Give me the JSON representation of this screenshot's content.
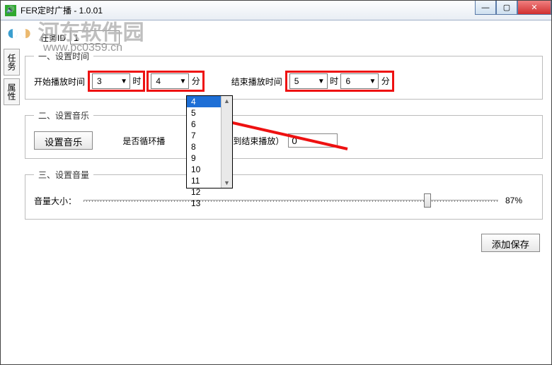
{
  "window": {
    "title": "FER定时广播 - 1.0.01",
    "icon_glyph": "🔊",
    "min": "—",
    "max": "▢",
    "close": "✕"
  },
  "watermark": {
    "brand": "河东软件园",
    "url": "www.pc0359.cn"
  },
  "side_tabs": [
    "任务",
    "属性"
  ],
  "task": {
    "label": "任务ID",
    "value": "1"
  },
  "section1": {
    "legend": "一、设置时间",
    "start_label": "开始播放时间",
    "hour_unit": "时",
    "minute_unit": "分",
    "end_label": "结束播放时间",
    "start_hour": "3",
    "start_minute": "4",
    "end_hour": "5",
    "end_minute": "6",
    "minute_options": [
      "4",
      "5",
      "6",
      "7",
      "8",
      "9",
      "10",
      "11",
      "12",
      "13"
    ]
  },
  "section2": {
    "legend": "二、设置音乐",
    "set_music_btn": "设置音乐",
    "loop_label": "是否循环播",
    "loop_until_label": "循环到结束播放）",
    "loop_value": "0"
  },
  "section3": {
    "legend": "三、设置音量",
    "vol_label": "音量大小：",
    "vol_percent": "87%",
    "vol_value": 87
  },
  "save_btn": "添加保存"
}
